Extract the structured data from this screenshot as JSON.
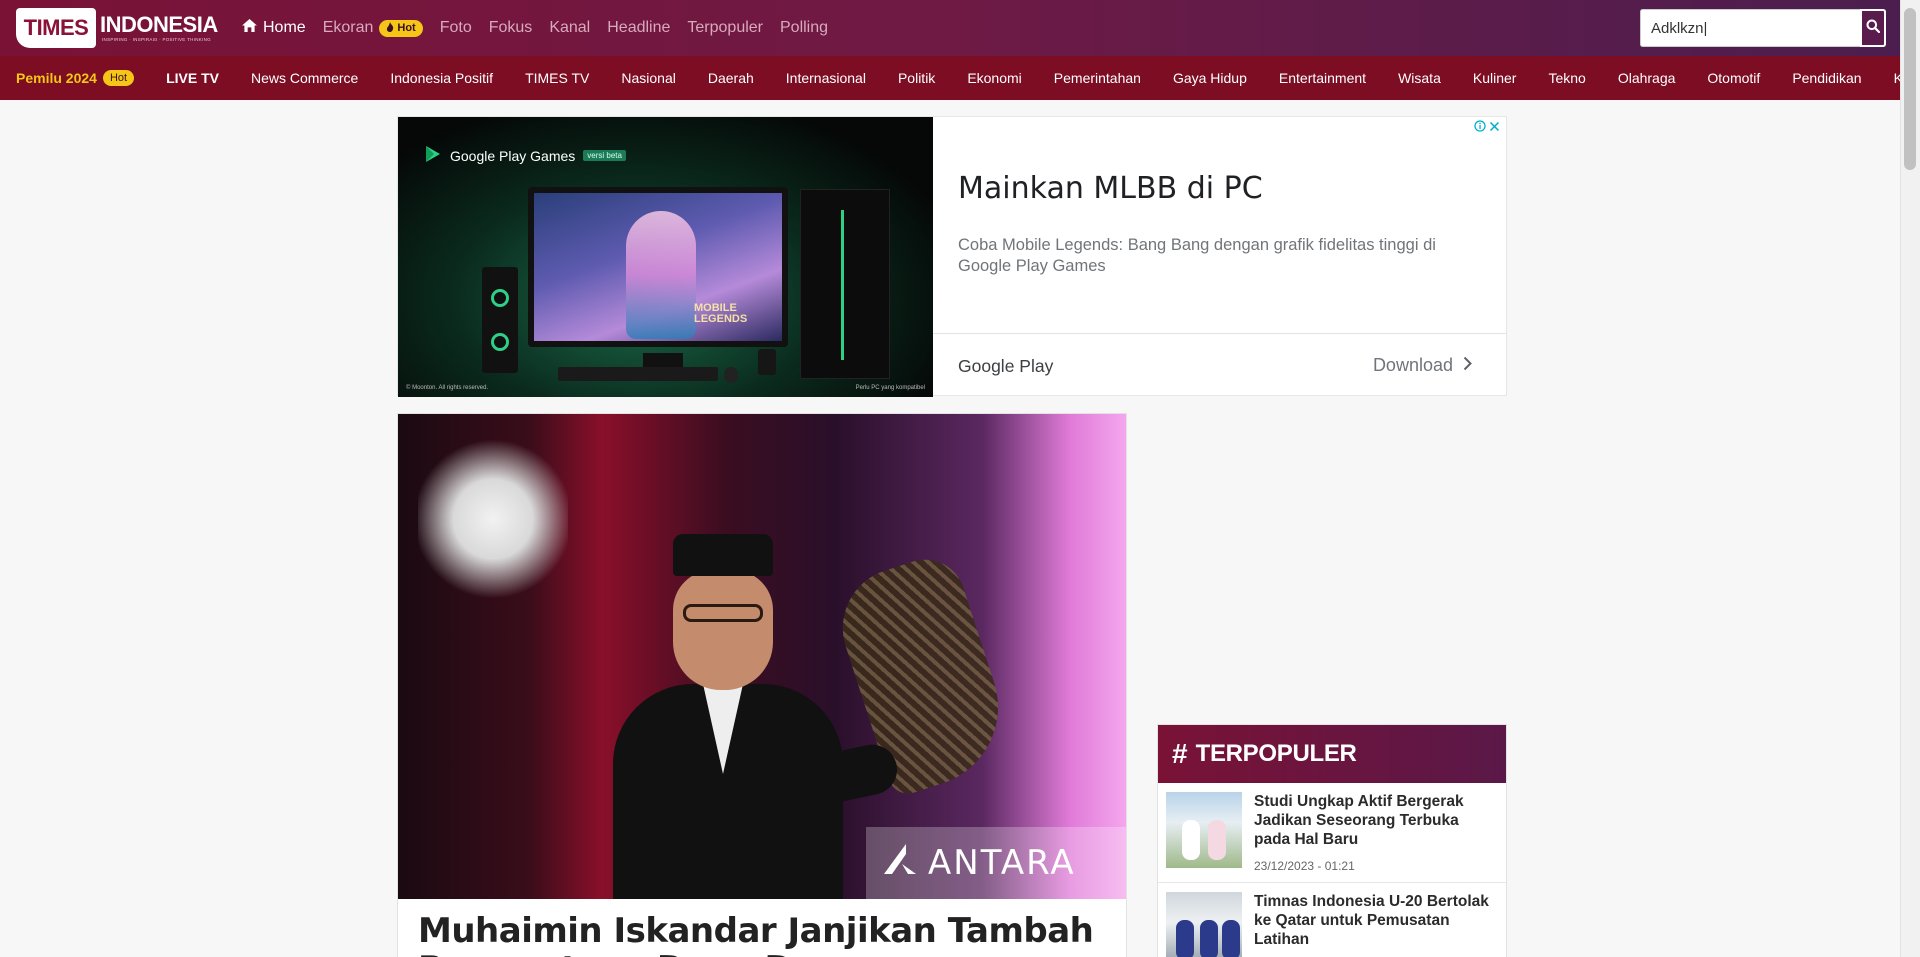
{
  "header": {
    "logo_times": "TIMES",
    "logo_indonesia": "INDONESIA",
    "logo_tagline": "INSPIRING · INSPIRASI · POSITIVE THINKING",
    "nav": [
      {
        "label": "Home",
        "active": true
      },
      {
        "label": "Ekoran",
        "badge": "Hot"
      },
      {
        "label": "Foto"
      },
      {
        "label": "Fokus"
      },
      {
        "label": "Kanal"
      },
      {
        "label": "Headline"
      },
      {
        "label": "Terpopuler"
      },
      {
        "label": "Polling"
      }
    ],
    "search_value": "Adklkzn|"
  },
  "categories": {
    "first": "Pemilu 2024",
    "first_badge": "Hot",
    "items": [
      "LIVE TV",
      "News Commerce",
      "Indonesia Positif",
      "TIMES TV",
      "Nasional",
      "Daerah",
      "Internasional",
      "Politik",
      "Ekonomi",
      "Pemerintahan",
      "Gaya Hidup",
      "Entertainment",
      "Wisata",
      "Kuliner",
      "Tekno",
      "Olahraga",
      "Otomotif",
      "Pendidikan",
      "Keseh"
    ]
  },
  "ad": {
    "brand": "Google Play Games",
    "brand_tag": "versi beta",
    "game_logo": "MOBILE LEGENDS",
    "copyright": "© Moonton. All rights reserved.",
    "note": "Perlu PC yang kompatibel",
    "title": "Mainkan MLBB di PC",
    "description": "Coba Mobile Legends: Bang Bang dengan grafik fidelitas tinggi di Google Play Games",
    "store": "Google Play",
    "cta": "Download"
  },
  "article": {
    "watermark": "ANTARA",
    "title": "Muhaimin Iskandar Janjikan Tambah Pemerataan Dana Desa"
  },
  "popular": {
    "heading": "TERPOPULER",
    "items": [
      {
        "headline": "Studi Ungkap Aktif Bergerak Jadikan Seseorang Terbuka pada Hal Baru",
        "date": "23/12/2023 - 01:21"
      },
      {
        "headline": "Timnas Indonesia U-20 Bertolak ke Qatar untuk Pemusatan Latihan",
        "date": ""
      }
    ]
  },
  "colors": {
    "header": "#7a1236",
    "category_bar": "#7d0d22",
    "hot_badge": "#f5c518"
  }
}
